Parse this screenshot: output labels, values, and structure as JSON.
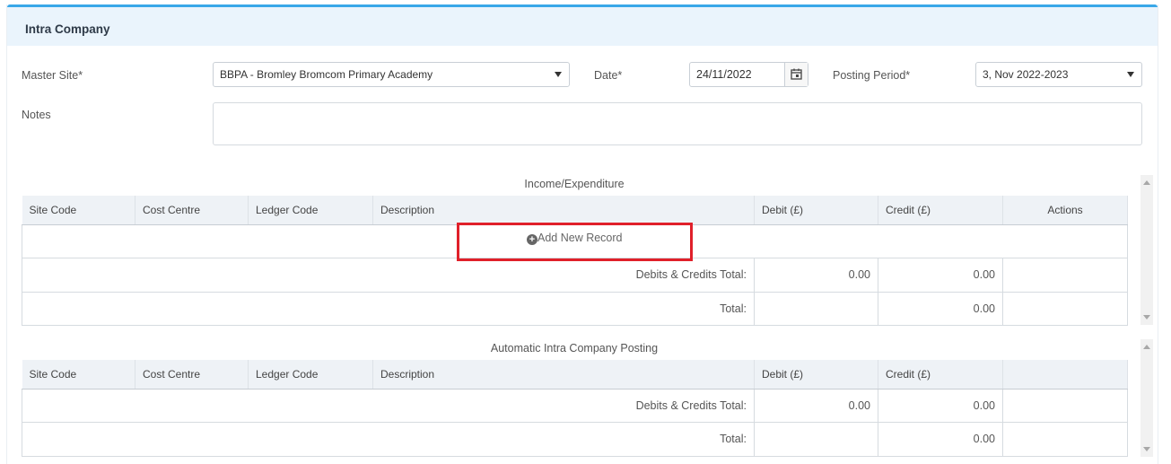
{
  "panel": {
    "title": "Intra Company"
  },
  "form": {
    "master_site_label": "Master Site*",
    "master_site_value": "BBPA - Bromley Bromcom Primary Academy",
    "date_label": "Date*",
    "date_value": "24/11/2022",
    "posting_period_label": "Posting Period*",
    "posting_period_value": "3, Nov 2022-2023",
    "notes_label": "Notes",
    "notes_value": ""
  },
  "income": {
    "title": "Income/Expenditure",
    "columns": [
      "Site Code",
      "Cost Centre",
      "Ledger Code",
      "Description",
      "Debit (£)",
      "Credit (£)",
      "Actions"
    ],
    "add_record_label": "Add New Record",
    "subtotal_label": "Debits & Credits Total:",
    "subtotal_debit": "0.00",
    "subtotal_credit": "0.00",
    "total_label": "Total:",
    "total_value": "0.00"
  },
  "auto": {
    "title": "Automatic Intra Company Posting",
    "columns": [
      "Site Code",
      "Cost Centre",
      "Ledger Code",
      "Description",
      "Debit (£)",
      "Credit (£)",
      ""
    ],
    "subtotal_label": "Debits & Credits Total:",
    "subtotal_debit": "0.00",
    "subtotal_credit": "0.00",
    "total_label": "Total:",
    "total_value": "0.00"
  },
  "colors": {
    "accent": "#39a7e8",
    "header_bg": "#eaf4fc",
    "highlight": "#e0202a"
  },
  "icons": {
    "calendar": "calendar-icon",
    "add": "plus-circle-icon"
  }
}
